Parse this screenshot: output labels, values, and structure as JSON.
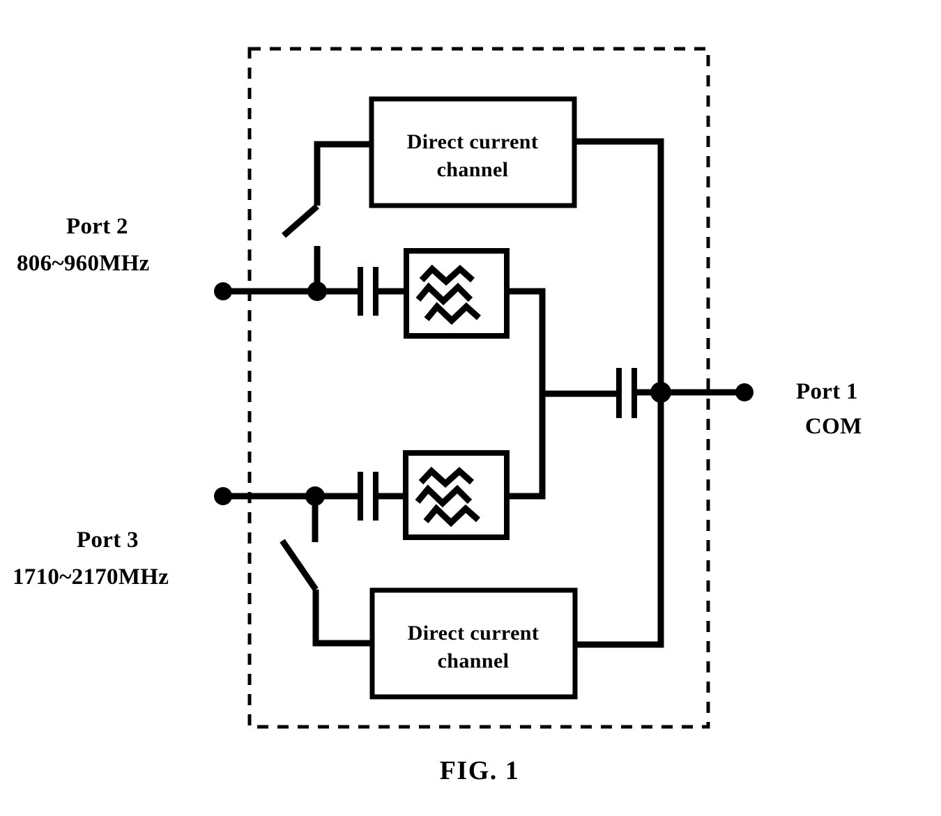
{
  "figure": {
    "caption": "FIG. 1",
    "type": "patent-schematic-diagram",
    "description": "Antenna multiplexer schematic with two direct current channels, two band filters, coupling capacitors and three ports"
  },
  "ports": [
    {
      "id": "port-2",
      "name": "Port 2",
      "band": "806~960MHz",
      "position": "left-upper"
    },
    {
      "id": "port-3",
      "name": "Port 3",
      "band": "1710~2170MHz",
      "position": "left-lower"
    },
    {
      "id": "port-1",
      "name": "Port 1",
      "band": "COM",
      "position": "right-center"
    }
  ],
  "blocks": [
    {
      "id": "dc-channel-top",
      "line1": "Direct current",
      "line2": "channel"
    },
    {
      "id": "dc-channel-bottom",
      "line1": "Direct current",
      "line2": "channel"
    }
  ],
  "filters": [
    {
      "id": "filter-upper",
      "symbol": "wavy-lines-filter"
    },
    {
      "id": "filter-lower",
      "symbol": "wavy-lines-filter"
    }
  ],
  "capacitors": [
    {
      "id": "cap-port2"
    },
    {
      "id": "cap-port3"
    },
    {
      "id": "cap-common"
    }
  ],
  "switches": [
    {
      "id": "switch-top"
    },
    {
      "id": "switch-bottom"
    }
  ],
  "colors": {
    "stroke": "#000000",
    "background": "#ffffff"
  }
}
